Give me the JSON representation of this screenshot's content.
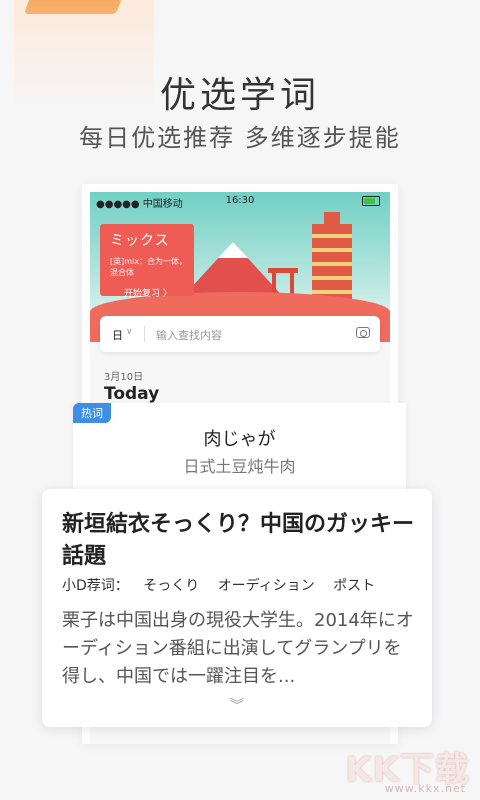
{
  "headline": "优选学词",
  "subline": "每日优选推荐  多维逐步提能",
  "phone": {
    "status": {
      "carrier": "●●●●● 中国移动",
      "time": "16:30"
    },
    "word_card": {
      "word": "ミックス",
      "definition": "[英]mix：合为一体，混合体",
      "review": "开始复习 〉"
    },
    "search": {
      "lang": "日",
      "chevron": "∨",
      "placeholder": "输入查找内容"
    },
    "date": "3月10日",
    "today": "Today"
  },
  "hot": {
    "badge": "热词",
    "word": "肉じゃが",
    "meaning": "日式土豆炖牛肉"
  },
  "article": {
    "title": "新垣結衣そっくり？中国のガッキー話題",
    "tags_label": "小D荐词：",
    "tags": [
      "そっくり",
      "オーディション",
      "ポスト"
    ],
    "body": "栗子は中国出身の現役大学生。2014年にオーディション番組に出演してグランプリを得し、中国では一躍注目を...",
    "more": "︾"
  },
  "watermark": {
    "text": "KK下载",
    "url": "www.kkx.net"
  },
  "colors": {
    "accent_red": "#ef5b55",
    "badge_blue": "#3d8fe5",
    "teal": "#71cfc4"
  }
}
